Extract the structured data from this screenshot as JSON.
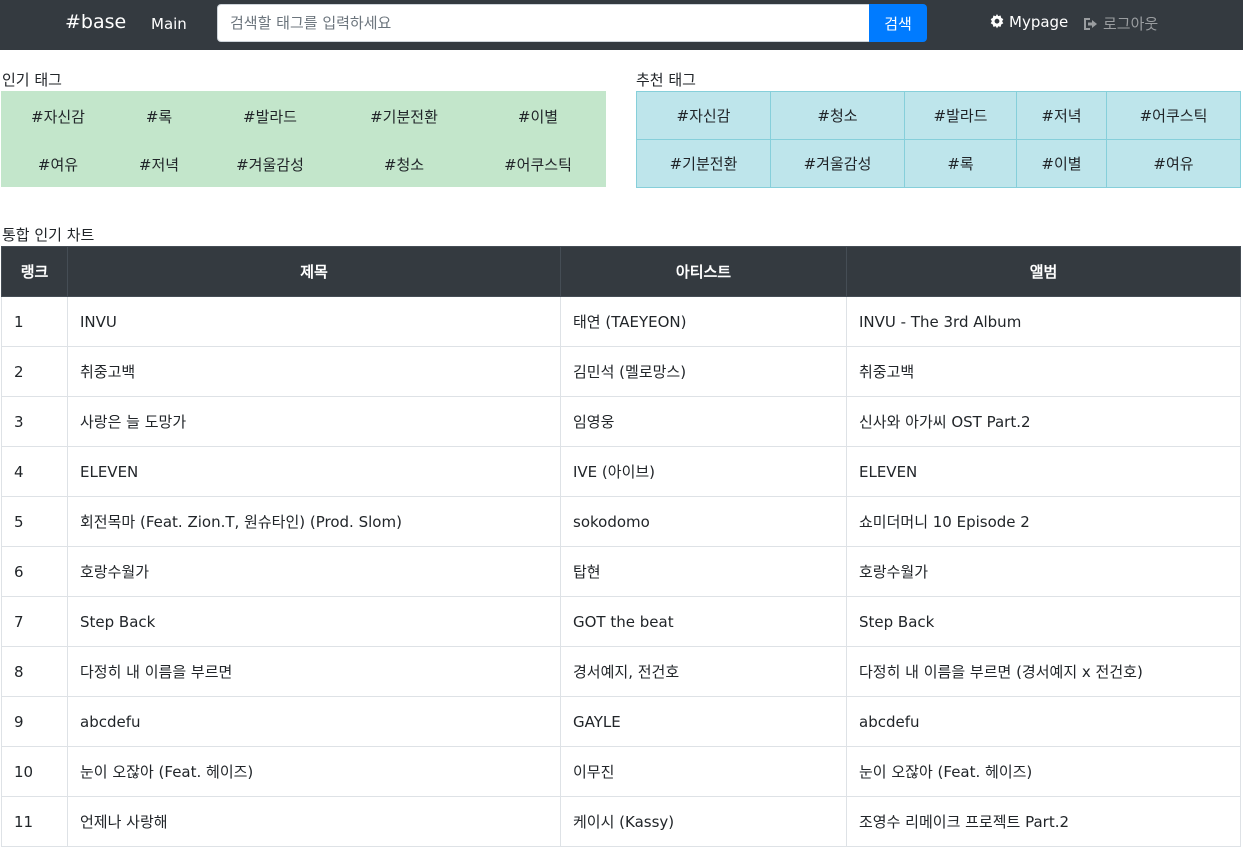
{
  "nav": {
    "brand": "#base",
    "main_link": "Main",
    "search_placeholder": "검색할 태그를 입력하세요",
    "search_value": "",
    "search_button": "검색",
    "mypage": "Mypage",
    "logout": "로그아웃"
  },
  "popular": {
    "title": "인기 태그",
    "tags": [
      "#자신감",
      "#록",
      "#발라드",
      "#기분전환",
      "#이별",
      "#여유",
      "#저녁",
      "#겨울감성",
      "#청소",
      "#어쿠스틱"
    ]
  },
  "recommended": {
    "title": "추천 태그",
    "tags": [
      "#자신감",
      "#청소",
      "#발라드",
      "#저녁",
      "#어쿠스틱",
      "#기분전환",
      "#겨울감성",
      "#록",
      "#이별",
      "#여유"
    ]
  },
  "chart": {
    "title": "통합 인기 차트",
    "headers": [
      "랭크",
      "제목",
      "아티스트",
      "앨범"
    ],
    "rows": [
      {
        "rank": "1",
        "title": "INVU",
        "artist": "태연 (TAEYEON)",
        "album": "INVU - The 3rd Album"
      },
      {
        "rank": "2",
        "title": "취중고백",
        "artist": "김민석 (멜로망스)",
        "album": "취중고백"
      },
      {
        "rank": "3",
        "title": "사랑은 늘 도망가",
        "artist": "임영웅",
        "album": "신사와 아가씨 OST Part.2"
      },
      {
        "rank": "4",
        "title": "ELEVEN",
        "artist": "IVE (아이브)",
        "album": "ELEVEN"
      },
      {
        "rank": "5",
        "title": "회전목마 (Feat. Zion.T, 원슈타인) (Prod. Slom)",
        "artist": "sokodomo",
        "album": "쇼미더머니 10 Episode 2"
      },
      {
        "rank": "6",
        "title": "호랑수월가",
        "artist": "탑현",
        "album": "호랑수월가"
      },
      {
        "rank": "7",
        "title": "Step Back",
        "artist": "GOT the beat",
        "album": "Step Back"
      },
      {
        "rank": "8",
        "title": "다정히 내 이름을 부르면",
        "artist": "경서예지, 전건호",
        "album": "다정히 내 이름을 부르면 (경서예지 x 전건호)"
      },
      {
        "rank": "9",
        "title": "abcdefu",
        "artist": "GAYLE",
        "album": "abcdefu"
      },
      {
        "rank": "10",
        "title": "눈이 오잖아 (Feat. 헤이즈)",
        "artist": "이무진",
        "album": "눈이 오잖아 (Feat. 헤이즈)"
      },
      {
        "rank": "11",
        "title": "언제나 사랑해",
        "artist": "케이시 (Kassy)",
        "album": "조영수 리메이크 프로젝트 Part.2"
      }
    ]
  },
  "icons": {
    "mypage": "gear-icon",
    "logout": "sign-out-icon"
  },
  "colors": {
    "navbar": "#343a40",
    "search_button": "#007bff",
    "popular_bg": "#c3e6cb",
    "recommended_bg": "#bee5eb"
  }
}
